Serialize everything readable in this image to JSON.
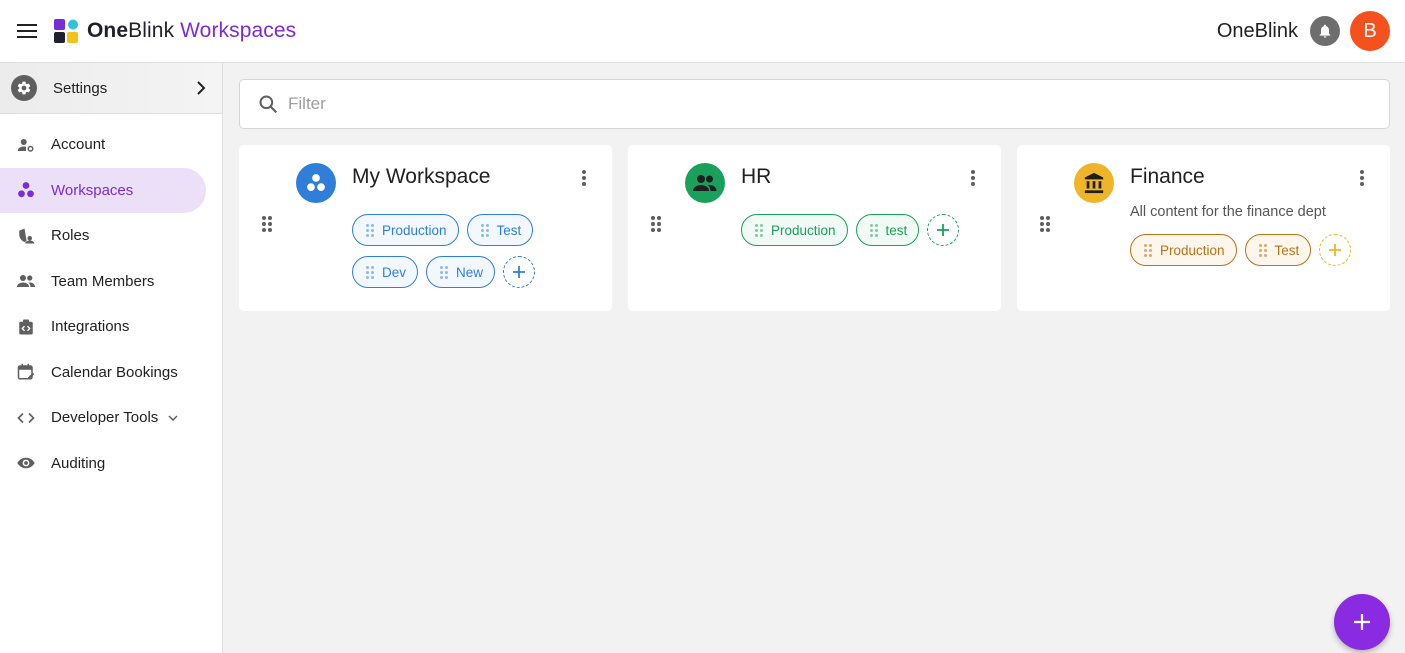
{
  "header": {
    "brand_bold": "One",
    "brand_rest": "Blink",
    "brand_suffix": "Workspaces",
    "org_name": "OneBlink",
    "avatar_initial": "B"
  },
  "sidebar": {
    "settings_label": "Settings",
    "items": [
      {
        "label": "Account",
        "icon": "user-gear-icon"
      },
      {
        "label": "Workspaces",
        "icon": "workspaces-icon",
        "active": true
      },
      {
        "label": "Roles",
        "icon": "roles-icon"
      },
      {
        "label": "Team Members",
        "icon": "people-icon"
      },
      {
        "label": "Integrations",
        "icon": "integrations-icon"
      },
      {
        "label": "Calendar Bookings",
        "icon": "calendar-edit-icon"
      },
      {
        "label": "Developer Tools",
        "icon": "code-icon"
      },
      {
        "label": "Auditing",
        "icon": "eye-icon"
      }
    ]
  },
  "filter": {
    "placeholder": "Filter"
  },
  "workspaces": [
    {
      "title": "My Workspace",
      "description": "",
      "color": "#2f7fd8",
      "tags": [
        "Production",
        "Test",
        "Dev",
        "New"
      ]
    },
    {
      "title": "HR",
      "description": "",
      "color": "#19a05a",
      "tags": [
        "Production",
        "test"
      ]
    },
    {
      "title": "Finance",
      "description": "All content for the finance dept",
      "color": "#f0b429",
      "tags": [
        "Production",
        "Test"
      ]
    }
  ],
  "colors": {
    "accent": "#7b2cd6",
    "fab": "#8a2be2",
    "avatar": "#f4511e"
  }
}
